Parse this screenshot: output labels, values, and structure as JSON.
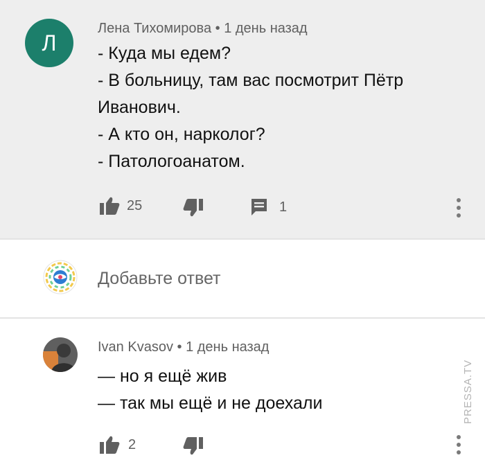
{
  "comment1": {
    "avatar_letter": "Л",
    "author": "Лена Тихомирова",
    "time": "• 1 день назад",
    "text": "- Куда мы едем?\n- В больницу, там вас посмотрит Пётр\nИванович.\n- А кто он, нарколог?\n- Патологоанатом.",
    "likes": "25",
    "replies": "1"
  },
  "reply": {
    "placeholder": "Добавьте ответ"
  },
  "comment2": {
    "author": "Ivan Kvasov",
    "time": "• 1 день назад",
    "text": "— но я ещё жив\n— так мы ещё и не доехали",
    "likes": "2"
  },
  "watermark": "PRESSA.TV",
  "colors": {
    "avatar_bg": "#1c7f6b",
    "comment_bg": "#eeeeee"
  },
  "icons": [
    "thumb-up-icon",
    "thumb-down-icon",
    "reply-icon",
    "more-vert-icon"
  ]
}
